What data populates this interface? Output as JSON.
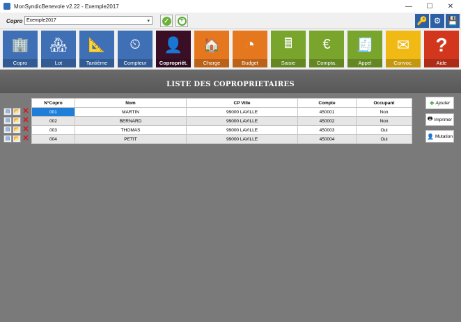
{
  "window": {
    "title": "MonSyndicBenevole v2.22 - Exemple2017",
    "minimize": "—",
    "maximize": "☐",
    "close": "✕"
  },
  "copro": {
    "label": "Copro",
    "selected": "Exemple2017",
    "validate_icon": "✓",
    "add_icon": "+"
  },
  "tools": {
    "key_icon": "🔑",
    "settings_icon": "⚙",
    "save_icon": "💾"
  },
  "modules": [
    {
      "label": "Copro",
      "icon": "🏢",
      "color": "#3f6fb4"
    },
    {
      "label": "Lot",
      "icon": "🏘",
      "color": "#3f6fb4"
    },
    {
      "label": "Tantième",
      "icon": "📐",
      "color": "#3f6fb4"
    },
    {
      "label": "Compteur",
      "icon": "⏲",
      "color": "#3f6fb4"
    },
    {
      "label": "Copropriét.",
      "icon": "👤",
      "color": "#3a0e24"
    },
    {
      "label": "Charge",
      "icon": "🏠",
      "color": "#e5781f"
    },
    {
      "label": "Budget",
      "icon": "◔",
      "color": "#e5781f"
    },
    {
      "label": "Saisie",
      "icon": "🖩",
      "color": "#7aa52c"
    },
    {
      "label": "Compta.",
      "icon": "€",
      "color": "#7aa52c"
    },
    {
      "label": "Appel",
      "icon": "🧾",
      "color": "#7aa52c"
    },
    {
      "label": "Convoc.",
      "icon": "✉",
      "color": "#f0b914"
    },
    {
      "label": "Aide",
      "icon": "?",
      "color": "#d2361d"
    }
  ],
  "list": {
    "title": "LISTE DES COPROPRIETAIRES",
    "headers": {
      "num": "N°Copro",
      "nom": "Nom",
      "cpville": "CP Ville",
      "compte": "Compte",
      "occupant": "Occupant"
    },
    "rows": [
      {
        "num": "001",
        "nom": "MARTIN",
        "cpville": "99000 LAVILLE",
        "compte": "450001",
        "occupant": "Non"
      },
      {
        "num": "002",
        "nom": "BERNARD",
        "cpville": "99000 LAVILLE",
        "compte": "450002",
        "occupant": "Non"
      },
      {
        "num": "003",
        "nom": "THOMAS",
        "cpville": "99000 LAVILLE",
        "compte": "450003",
        "occupant": "Oui"
      },
      {
        "num": "004",
        "nom": "PETIT",
        "cpville": "99000 LAVILLE",
        "compte": "450004",
        "occupant": "Oui"
      }
    ],
    "row_icons": {
      "edit": "▤",
      "open": "📂",
      "delete": "✕"
    }
  },
  "actions": {
    "add": {
      "label": "Ajouter",
      "icon": "✚"
    },
    "print": {
      "label": "Imprimer",
      "icon": "🖶"
    },
    "mutation": {
      "label": "Mutation",
      "icon": "👤"
    }
  }
}
